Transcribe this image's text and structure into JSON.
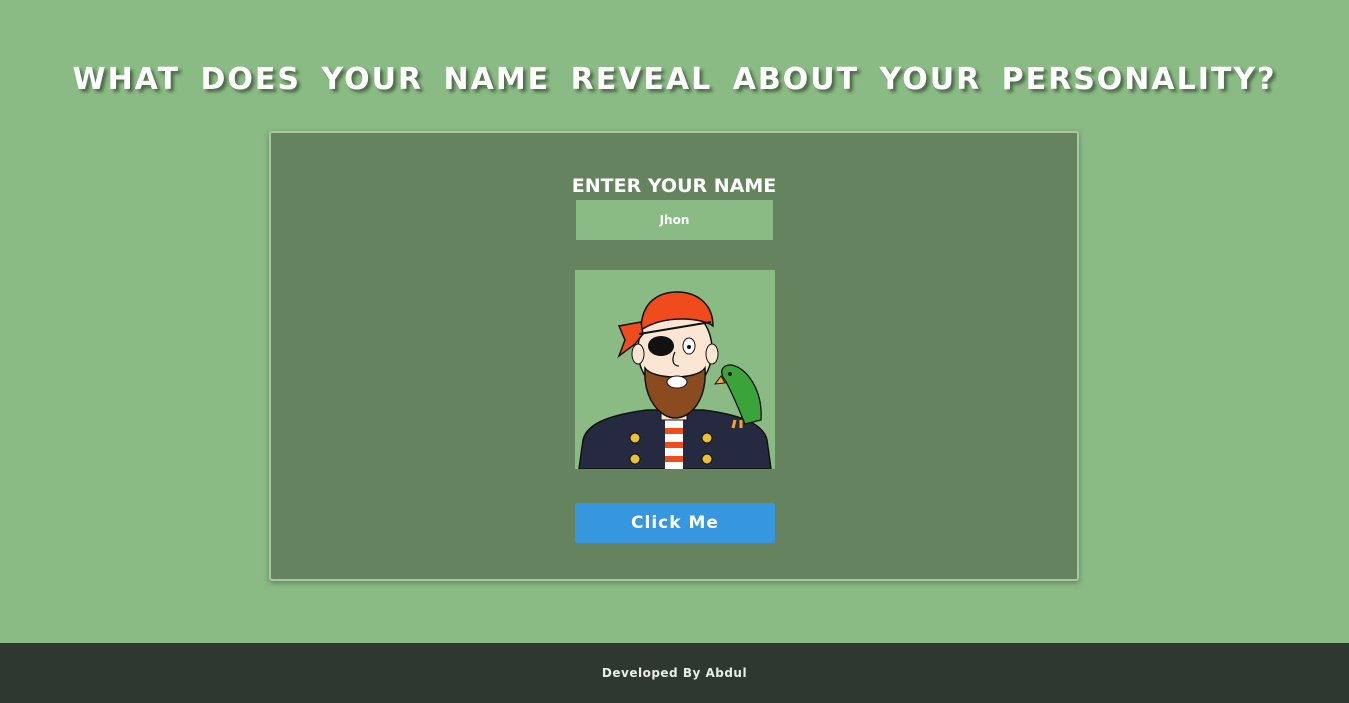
{
  "header": {
    "title": "WHAT DOES YOUR NAME REVEAL ABOUT YOUR PERSONALITY?"
  },
  "form": {
    "label": "ENTER YOUR NAME",
    "name_value": "Jhon",
    "avatar": "pirate-with-parrot-illustration",
    "button_label": "Click Me"
  },
  "footer": {
    "credit": "Developed By Abdul"
  },
  "colors": {
    "background": "#8abb84",
    "card": "#64835e",
    "button": "#3797de",
    "footer": "#2f382f"
  }
}
